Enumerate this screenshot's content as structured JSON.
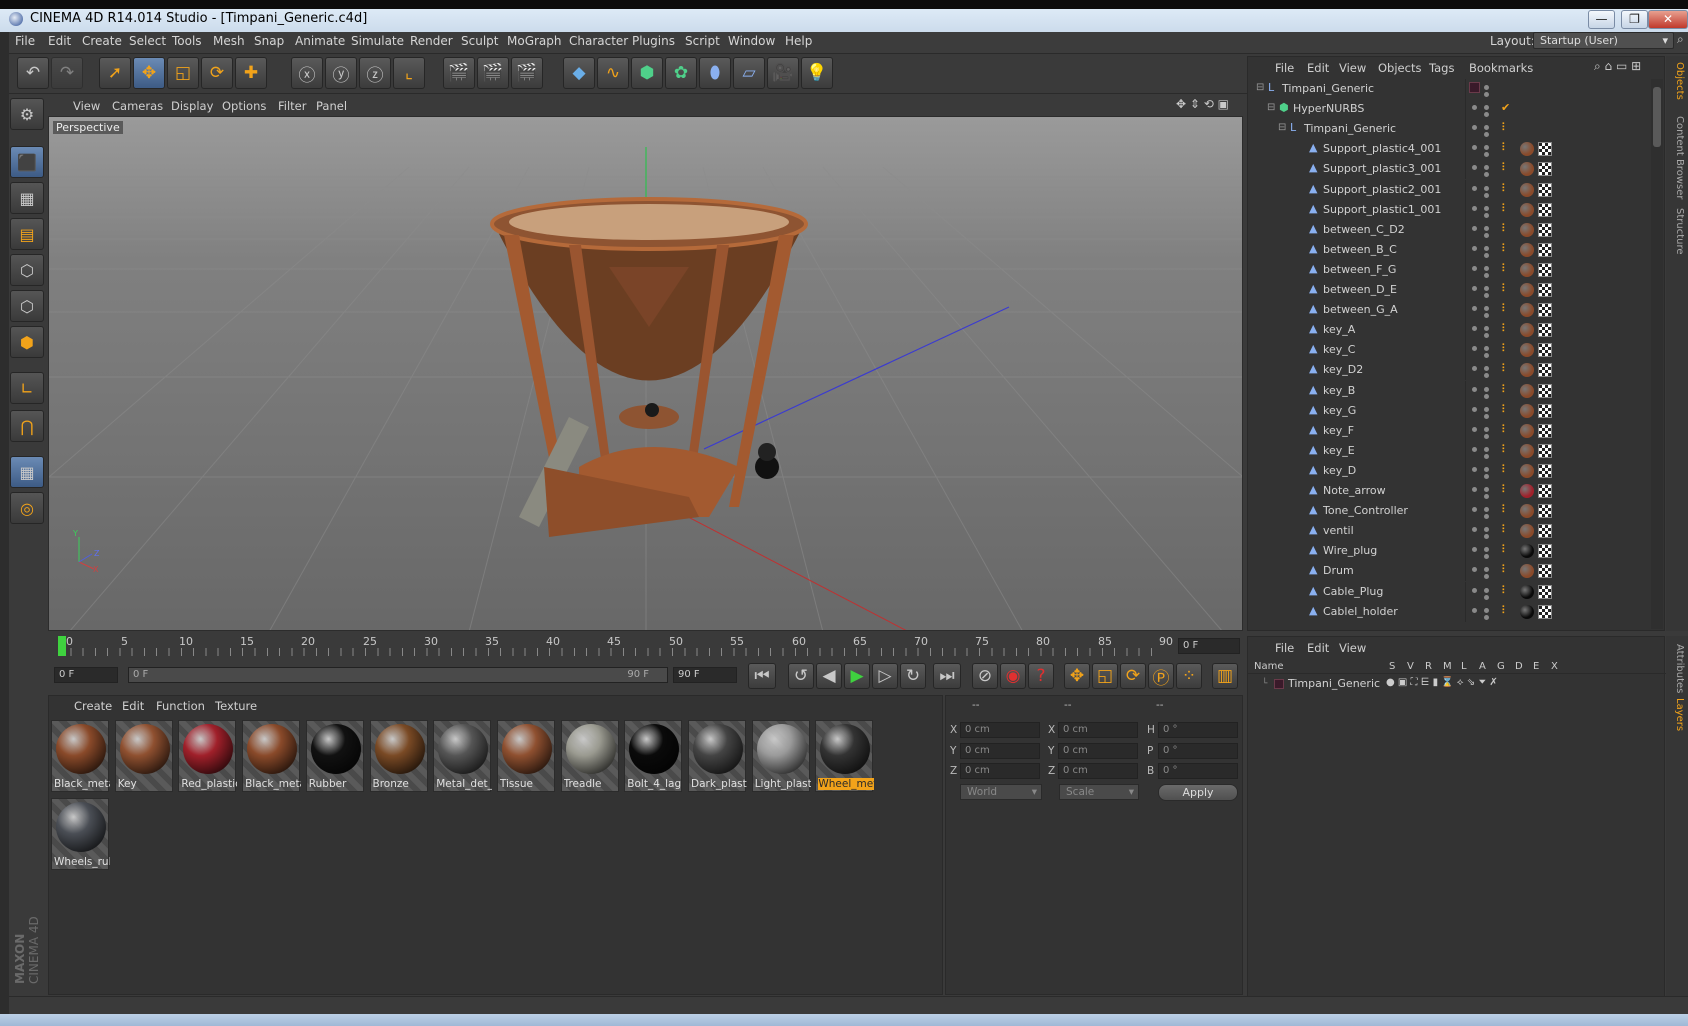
{
  "window": {
    "title": "CINEMA 4D R14.014 Studio - [Timpani_Generic.c4d]",
    "min": "—",
    "max": "❐",
    "close": "✕"
  },
  "menu": [
    "File",
    "Edit",
    "Create",
    "Select",
    "Tools",
    "Mesh",
    "Snap",
    "Animate",
    "Simulate",
    "Render",
    "Sculpt",
    "MoGraph",
    "Character",
    "Plugins",
    "Script",
    "Window",
    "Help"
  ],
  "layout": {
    "label": "Layout:",
    "value": "Startup (User)"
  },
  "viewport": {
    "menu": [
      "View",
      "Cameras",
      "Display",
      "Options",
      "Filter",
      "Panel"
    ],
    "label": "Perspective",
    "axis_x": "X",
    "axis_y": "Y",
    "axis_z": "Z"
  },
  "timeline": {
    "ticks": [
      "0",
      "5",
      "10",
      "15",
      "20",
      "25",
      "30",
      "35",
      "40",
      "45",
      "50",
      "55",
      "60",
      "65",
      "70",
      "75",
      "80",
      "85",
      "90"
    ],
    "current_frame": "0 F",
    "start_frame": "0 F",
    "slider_start": "0 F",
    "slider_end": "90 F",
    "end_frame": "90 F"
  },
  "objects_panel": {
    "menu": [
      "File",
      "Edit",
      "View",
      "Objects",
      "Tags",
      "Bookmarks"
    ],
    "rows": [
      {
        "name": "Timpani_Generic",
        "level": 0
      },
      {
        "name": "HyperNURBS",
        "level": 1
      },
      {
        "name": "Timpani_Generic",
        "level": 2
      },
      {
        "name": "Support_plastic4_001",
        "level": 3
      },
      {
        "name": "Support_plastic3_001",
        "level": 3
      },
      {
        "name": "Support_plastic2_001",
        "level": 3
      },
      {
        "name": "Support_plastic1_001",
        "level": 3
      },
      {
        "name": "between_C_D2",
        "level": 3
      },
      {
        "name": "between_B_C",
        "level": 3
      },
      {
        "name": "between_F_G",
        "level": 3
      },
      {
        "name": "between_D_E",
        "level": 3
      },
      {
        "name": "between_G_A",
        "level": 3
      },
      {
        "name": "key_A",
        "level": 3
      },
      {
        "name": "key_C",
        "level": 3
      },
      {
        "name": "key_D2",
        "level": 3
      },
      {
        "name": "key_B",
        "level": 3
      },
      {
        "name": "key_G",
        "level": 3
      },
      {
        "name": "key_F",
        "level": 3
      },
      {
        "name": "key_E",
        "level": 3
      },
      {
        "name": "key_D",
        "level": 3
      },
      {
        "name": "Note_arrow",
        "level": 3
      },
      {
        "name": "Tone_Controller",
        "level": 3
      },
      {
        "name": "ventil",
        "level": 3
      },
      {
        "name": "Wire_plug",
        "level": 3
      },
      {
        "name": "Drum",
        "level": 3
      },
      {
        "name": "Cable_Plug",
        "level": 3
      },
      {
        "name": "Cablel_holder",
        "level": 3
      }
    ]
  },
  "side_tabs": [
    "Objects",
    "Content Browser",
    "Structure"
  ],
  "layers_panel": {
    "menu": [
      "File",
      "Edit",
      "View"
    ],
    "columns": [
      "Name",
      "S",
      "V",
      "R",
      "M",
      "L",
      "A",
      "G",
      "D",
      "E",
      "X"
    ],
    "rows": [
      {
        "name": "Timpani_Generic"
      }
    ]
  },
  "layer_tabs": [
    "Attributes",
    "Layers"
  ],
  "materials": {
    "menu": [
      "Create",
      "Edit",
      "Function",
      "Texture"
    ],
    "items": [
      {
        "name": "Black_meta",
        "color": "#8a4a2a"
      },
      {
        "name": "Key",
        "color": "#8f5030"
      },
      {
        "name": "Red_plastic",
        "color": "#a0202a"
      },
      {
        "name": "Black_meta",
        "color": "#8a4a2a"
      },
      {
        "name": "Rubber",
        "color": "#111111"
      },
      {
        "name": "Bronze",
        "color": "#7a4a25"
      },
      {
        "name": "Metal_det_",
        "color": "#555555"
      },
      {
        "name": "Tissue",
        "color": "#8f5030"
      },
      {
        "name": "Treadle",
        "color": "#9a9a90"
      },
      {
        "name": "Bolt_4_lag",
        "color": "#0a0a0a"
      },
      {
        "name": "Dark_plasti",
        "color": "#444444"
      },
      {
        "name": "Light_plast",
        "color": "#9a9a9a"
      },
      {
        "name": "Wheel_met",
        "color": "#333333",
        "selected": true
      },
      {
        "name": "Wheels_rul",
        "color": "#4a4e55"
      }
    ]
  },
  "coords": {
    "header": [
      "--",
      "--",
      "--"
    ],
    "rows": [
      {
        "a": "X",
        "av": "0 cm",
        "b": "X",
        "bv": "0 cm",
        "c": "H",
        "cv": "0 °"
      },
      {
        "a": "Y",
        "av": "0 cm",
        "b": "Y",
        "bv": "0 cm",
        "c": "P",
        "cv": "0 °"
      },
      {
        "a": "Z",
        "av": "0 cm",
        "b": "Z",
        "bv": "0 cm",
        "c": "B",
        "cv": "0 °"
      }
    ],
    "mode": "World",
    "scale": "Scale",
    "apply": "Apply"
  },
  "brand": {
    "maxon": "MAXON",
    "product": "CINEMA 4D"
  },
  "colors": {
    "accent": "#f2a31a",
    "selection": "#4a6b98",
    "bg": "#3a3a3a"
  }
}
